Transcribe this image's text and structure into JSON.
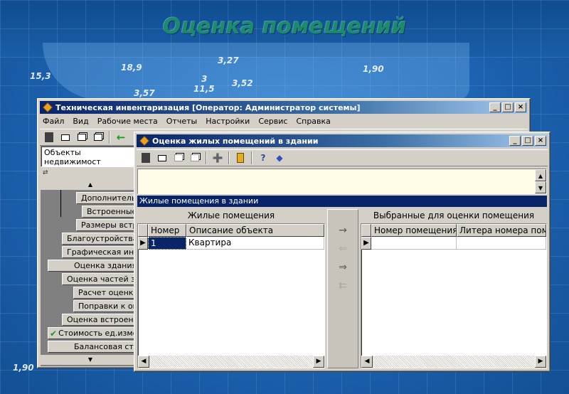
{
  "page_title": "Оценка помещений",
  "background_dims": [
    "15,3",
    "18,9",
    "3,27",
    "1,90",
    "3",
    "11,5",
    "3,52",
    "3,57",
    "1,90"
  ],
  "back_window": {
    "title": "Техническая инвентаризация [Оператор: Администратор системы]",
    "menu": [
      "Файл",
      "Вид",
      "Рабочие места",
      "Отчеты",
      "Настройки",
      "Сервис",
      "Справка"
    ],
    "info_text": "Объекты недвижимост",
    "tree_items": [
      "Дополнительн",
      "Встроенные п",
      "Размеры встр",
      "Благоустройства",
      "Графическая инф",
      "Оценка здания",
      "Оценка частей зд",
      "Расчет оценки",
      "Поправки к оце",
      "Оценка встроенн",
      "Стоимость ед.изме",
      "Балансовая сто"
    ]
  },
  "front_window": {
    "title": "Оценка жилых помещений в здании",
    "section_header": "Жилые помещения в здании",
    "left_pane": {
      "title": "Жилые помещения",
      "columns": [
        "Номер",
        "Описание объекта"
      ],
      "rows": [
        {
          "number": "1",
          "description": "Квартира"
        }
      ]
    },
    "right_pane": {
      "title": "Выбранные для оценки помещения",
      "columns": [
        "Номер помещения",
        "Литера номера пом"
      ]
    },
    "transfer_buttons": [
      "→",
      "⇐",
      "⇒",
      "⇇"
    ]
  },
  "colors": {
    "title_bar": "#0a246a",
    "window_face": "#d4d0c8",
    "info_panel": "#fffde8",
    "page_title": "#1e8a6c"
  }
}
